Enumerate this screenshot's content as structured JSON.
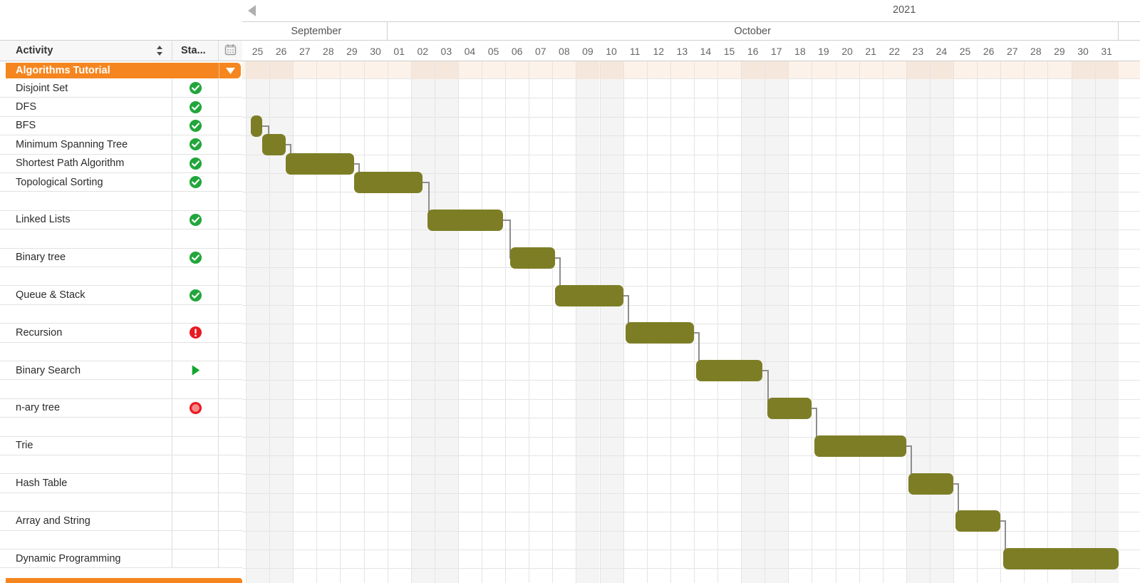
{
  "window": {
    "title": "Gantt Chart - Algorithms Tutorial",
    "accent_orange": "#f5861f",
    "bar_color": "#7d7d26",
    "link_color": "#8e8e8e",
    "summary_band_color": "#fdf2e9",
    "weekend_shade": "#f4f4f4"
  },
  "grid": {
    "columns": [
      {
        "label": "Activity",
        "key": "activity",
        "sortable": true,
        "sort_icon": "sort-arrows-icon"
      },
      {
        "label": "Sta...",
        "key": "status",
        "full_label": "Status"
      },
      {
        "label": "",
        "key": "calendar",
        "icon": "calendar-icon"
      }
    ],
    "summary_row": {
      "label": "Algorithms Tutorial",
      "caret": "chevron-down-icon",
      "selected": true
    },
    "rows": [
      {
        "name": "Disjoint Set",
        "status": "complete",
        "status_icon": "check-circle-green-icon"
      },
      {
        "name": "DFS",
        "status": "complete",
        "status_icon": "check-circle-green-icon"
      },
      {
        "name": "BFS",
        "status": "complete",
        "status_icon": "check-circle-green-icon"
      },
      {
        "name": "Minimum Spanning Tree",
        "status": "complete",
        "status_icon": "check-circle-green-icon"
      },
      {
        "name": "Shortest Path Algorithm",
        "status": "complete",
        "status_icon": "check-circle-green-icon"
      },
      {
        "name": "Topological Sorting",
        "status": "complete",
        "status_icon": "check-circle-green-icon"
      },
      {
        "name": "",
        "status": "none",
        "status_icon": ""
      },
      {
        "name": "Linked Lists",
        "status": "complete",
        "status_icon": "check-circle-green-icon"
      },
      {
        "name": "",
        "status": "none",
        "status_icon": ""
      },
      {
        "name": "Binary tree",
        "status": "complete",
        "status_icon": "check-circle-green-icon"
      },
      {
        "name": "",
        "status": "none",
        "status_icon": ""
      },
      {
        "name": "Queue & Stack",
        "status": "complete",
        "status_icon": "check-circle-green-icon"
      },
      {
        "name": "",
        "status": "none",
        "status_icon": ""
      },
      {
        "name": "Recursion",
        "status": "alert",
        "status_icon": "exclamation-circle-red-icon"
      },
      {
        "name": "",
        "status": "none",
        "status_icon": ""
      },
      {
        "name": "Binary Search",
        "status": "in-progress",
        "status_icon": "play-triangle-green-icon"
      },
      {
        "name": "",
        "status": "none",
        "status_icon": ""
      },
      {
        "name": "n-ary tree",
        "status": "blocked",
        "status_icon": "stop-circle-red-icon"
      },
      {
        "name": "",
        "status": "none",
        "status_icon": ""
      },
      {
        "name": "Trie",
        "status": "none",
        "status_icon": ""
      },
      {
        "name": "",
        "status": "none",
        "status_icon": ""
      },
      {
        "name": "Hash Table",
        "status": "none",
        "status_icon": ""
      },
      {
        "name": "",
        "status": "none",
        "status_icon": ""
      },
      {
        "name": "Array and String",
        "status": "none",
        "status_icon": ""
      },
      {
        "name": "",
        "status": "none",
        "status_icon": ""
      },
      {
        "name": "Dynamic Programming",
        "status": "none",
        "status_icon": ""
      }
    ]
  },
  "timeline": {
    "year": "2021",
    "scroll_left_icon": "left-triangle-icon",
    "months": [
      {
        "label": "September",
        "days": 6
      },
      {
        "label": "October",
        "days": 31
      }
    ],
    "days": [
      "25",
      "26",
      "27",
      "28",
      "29",
      "30",
      "01",
      "02",
      "03",
      "04",
      "05",
      "06",
      "07",
      "08",
      "09",
      "10",
      "11",
      "12",
      "13",
      "14",
      "15",
      "16",
      "17",
      "18",
      "19",
      "20",
      "21",
      "22",
      "23",
      "24",
      "25",
      "26",
      "27",
      "28",
      "29",
      "30",
      "31"
    ],
    "weekend_day_indices": [
      0,
      1,
      7,
      8,
      14,
      15,
      21,
      22,
      28,
      29,
      35,
      36
    ]
  },
  "chart_data": {
    "type": "table",
    "title": "Algorithms Tutorial Gantt",
    "x_unit": "day",
    "x_start_label": "Sep 25",
    "x_end_label": "Oct 31",
    "bars": [
      {
        "activity": "BFS",
        "row_index": 2,
        "start_day_index": 0.2,
        "duration_days": 0.5
      },
      {
        "activity": "Minimum Spanning Tree",
        "row_index": 3,
        "start_day_index": 0.7,
        "duration_days": 1.0
      },
      {
        "activity": "Shortest Path Algorithm",
        "row_index": 4,
        "start_day_index": 1.7,
        "duration_days": 2.9
      },
      {
        "activity": "Topological Sorting",
        "row_index": 5,
        "start_day_index": 4.6,
        "duration_days": 2.9
      },
      {
        "activity": "Linked Lists",
        "row_index": 7,
        "start_day_index": 7.7,
        "duration_days": 3.2
      },
      {
        "activity": "Binary tree",
        "row_index": 9,
        "start_day_index": 11.2,
        "duration_days": 1.9
      },
      {
        "activity": "Queue & Stack",
        "row_index": 11,
        "start_day_index": 13.1,
        "duration_days": 2.9
      },
      {
        "activity": "Recursion",
        "row_index": 13,
        "start_day_index": 16.1,
        "duration_days": 2.9
      },
      {
        "activity": "Binary Search",
        "row_index": 15,
        "start_day_index": 19.1,
        "duration_days": 2.8
      },
      {
        "activity": "n-ary tree",
        "row_index": 17,
        "start_day_index": 22.1,
        "duration_days": 1.9
      },
      {
        "activity": "Trie",
        "row_index": 19,
        "start_day_index": 24.1,
        "duration_days": 3.9
      },
      {
        "activity": "Hash Table",
        "row_index": 21,
        "start_day_index": 28.1,
        "duration_days": 1.9
      },
      {
        "activity": "Array and String",
        "row_index": 23,
        "start_day_index": 30.1,
        "duration_days": 1.9
      },
      {
        "activity": "Dynamic Programming",
        "row_index": 25,
        "start_day_index": 32.1,
        "duration_days": 4.9
      }
    ],
    "dependencies": [
      {
        "from": "BFS",
        "to": "Minimum Spanning Tree",
        "type": "finish-to-start"
      },
      {
        "from": "Minimum Spanning Tree",
        "to": "Shortest Path Algorithm",
        "type": "finish-to-start"
      },
      {
        "from": "Shortest Path Algorithm",
        "to": "Topological Sorting",
        "type": "finish-to-start"
      },
      {
        "from": "Topological Sorting",
        "to": "Linked Lists",
        "type": "finish-to-start"
      },
      {
        "from": "Linked Lists",
        "to": "Binary tree",
        "type": "finish-to-start"
      },
      {
        "from": "Binary tree",
        "to": "Queue & Stack",
        "type": "finish-to-start"
      },
      {
        "from": "Queue & Stack",
        "to": "Recursion",
        "type": "finish-to-start"
      },
      {
        "from": "Recursion",
        "to": "Binary Search",
        "type": "finish-to-start"
      },
      {
        "from": "Binary Search",
        "to": "n-ary tree",
        "type": "finish-to-start"
      },
      {
        "from": "n-ary tree",
        "to": "Trie",
        "type": "finish-to-start"
      },
      {
        "from": "Trie",
        "to": "Hash Table",
        "type": "finish-to-start"
      },
      {
        "from": "Hash Table",
        "to": "Array and String",
        "type": "finish-to-start"
      },
      {
        "from": "Array and String",
        "to": "Dynamic Programming",
        "type": "finish-to-start"
      }
    ]
  }
}
